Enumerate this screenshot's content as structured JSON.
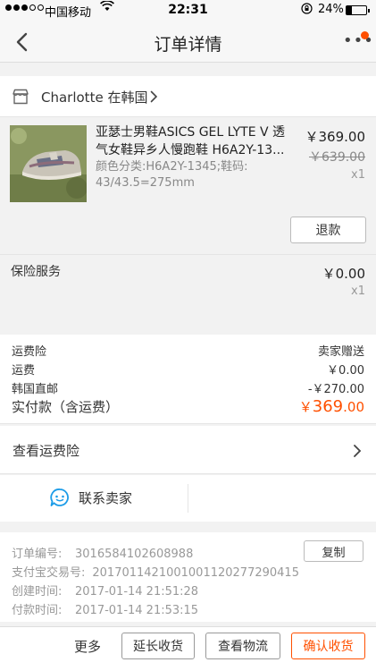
{
  "status_bar": {
    "carrier": "中国移动",
    "time": "22:31",
    "battery": "24%"
  },
  "nav": {
    "title": "订单详情",
    "more_label": "•••"
  },
  "shop": {
    "name": "Charlotte 在韩国"
  },
  "item": {
    "title": "亚瑟士男鞋ASICS GEL LYTE V 透气女鞋异乡人慢跑鞋 H6A2Y-13...",
    "sku": "颜色分类:H6A2Y-1345;鞋码: 43/43.5=275mm",
    "price": "￥369.00",
    "original_price": "￥639.00",
    "quantity": "x1",
    "refund_label": "退款",
    "image_watermark": "Charlotte"
  },
  "insurance": {
    "label": "保险服务",
    "price": "￥0.00",
    "quantity": "x1"
  },
  "fees": {
    "freight_insurance_label": "运费险",
    "freight_insurance_value": "卖家赠送",
    "shipping_label": "运费",
    "shipping_value": "￥0.00",
    "direct_mail_label": "韩国直邮",
    "direct_mail_value": "-￥270.00",
    "total_label": "实付款（含运费）",
    "total_currency": "￥",
    "total_int": "369",
    "total_dec": ".00"
  },
  "freight_link": {
    "label": "查看运费险"
  },
  "contact": {
    "label": "联系卖家"
  },
  "order": {
    "number_label": "订单编号:",
    "number_value": "3016584102608988",
    "copy_label": "复制",
    "alipay_label": "支付宝交易号:",
    "alipay_value": "2017011421001001120277290415",
    "created_label": "创建时间:",
    "created_value": "2017-01-14 21:51:28",
    "paid_label": "付款时间:",
    "paid_value": "2017-01-14 21:53:15"
  },
  "bottom_bar": {
    "more_label": "更多",
    "extend_label": "延长收货",
    "logistics_label": "查看物流",
    "confirm_label": "确认收货"
  },
  "colors": {
    "accent": "#ff5000",
    "background": "#f2f2f2",
    "contact_icon": "#1c9ce8"
  },
  "icons": {
    "back": "chevron-left-icon",
    "shop": "store-icon",
    "contact": "chat-bubble-icon",
    "arrow": "chevron-right-icon"
  }
}
